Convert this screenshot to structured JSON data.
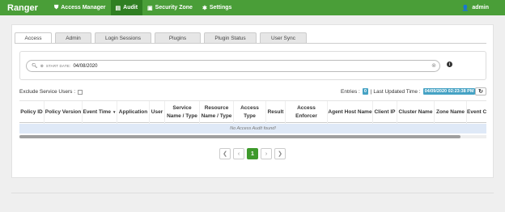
{
  "navbar": {
    "brand": "Ranger",
    "items": [
      {
        "label": "Access Manager",
        "icon": "shield-icon",
        "glyph": "⛊",
        "active": false
      },
      {
        "label": "Audit",
        "icon": "file-icon",
        "glyph": "▤",
        "active": true
      },
      {
        "label": "Security Zone",
        "icon": "zone-icon",
        "glyph": "▣",
        "active": false
      },
      {
        "label": "Settings",
        "icon": "gear-icon",
        "glyph": "✱",
        "active": false
      }
    ],
    "user": {
      "label": "admin",
      "icon": "user-icon",
      "glyph": "👤"
    }
  },
  "tabs": [
    "Access",
    "Admin",
    "Login Sessions",
    "Plugins",
    "Plugin Status",
    "User Sync"
  ],
  "search": {
    "chip_label": "START DATE:",
    "chip_value": "04/08/2020"
  },
  "filters": {
    "exclude_label": "Exclude Service Users :",
    "entries_label": "Entries :",
    "entries_count": "0",
    "last_updated_label": "| Last Updated Time :",
    "last_updated_value": "04/09/2020 02:23:38 PM"
  },
  "table": {
    "headers": [
      "Policy ID",
      "Policy Version",
      "Event Time",
      "Application",
      "User",
      "Service\nName / Type",
      "Resource\nName / Type",
      "Access Type",
      "Result",
      "Access Enforcer",
      "Agent Host Name",
      "Client IP",
      "Cluster Name",
      "Zone Name",
      "Event C"
    ],
    "empty_message": "No Access Audit found!"
  },
  "pagination": {
    "first": "❮",
    "prev": "‹",
    "current": "1",
    "next": "›",
    "last": "❯"
  },
  "colors": {
    "navbar": "#4a9e38",
    "navbar_active": "#2f7f22",
    "badge": "#45a2c4",
    "page_active": "#3e9a2c"
  }
}
